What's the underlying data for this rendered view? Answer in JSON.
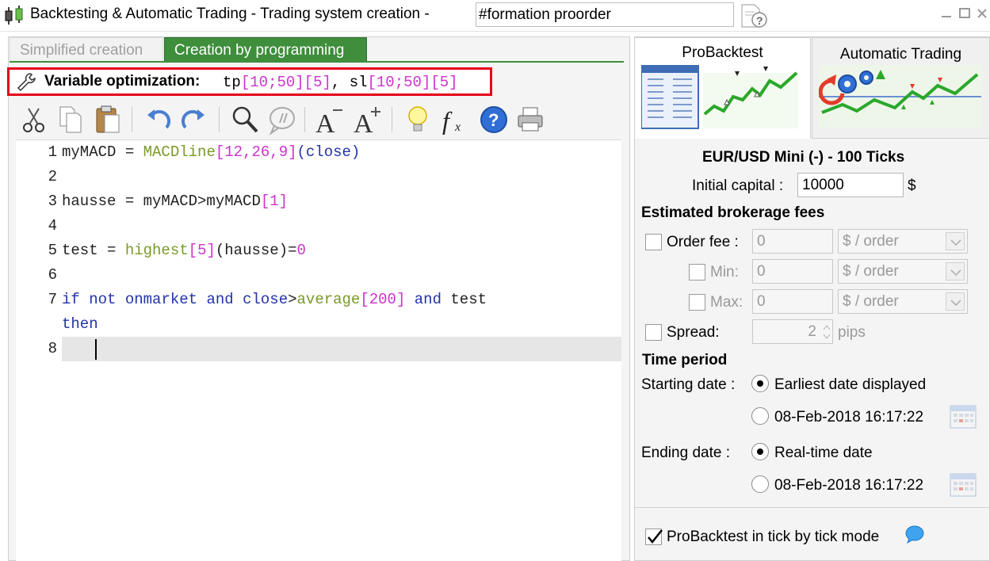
{
  "window": {
    "title": "Backtesting & Automatic Trading - Trading system creation -",
    "system_name": "#formation proorder"
  },
  "tabs": {
    "simplified": "Simplified creation",
    "programming": "Creation by programming"
  },
  "variable_optimization": {
    "label": "Variable optimization:",
    "tp_name": "tp",
    "tp_min": "10",
    "tp_max": "50",
    "tp_step": "5",
    "sl_name": "sl",
    "sl_min": "10",
    "sl_max": "50",
    "sl_step": "5"
  },
  "toolbar": {
    "icons": [
      "cut-icon",
      "copy-icon",
      "paste-icon",
      "undo-icon",
      "redo-icon",
      "search-icon",
      "comment-icon",
      "decrease-font-icon",
      "increase-font-icon",
      "lightbulb-icon",
      "function-icon",
      "help-icon",
      "print-icon"
    ]
  },
  "editor": {
    "line_numbers": [
      "1",
      "2",
      "3",
      "4",
      "5",
      "6",
      "7",
      "8"
    ],
    "l1": {
      "a": "myMACD = ",
      "fn": "MACDline",
      "b": "[",
      "n1": "12",
      "c1": ",",
      "n2": "26",
      "c2": ",",
      "n3": "9",
      "d": "]",
      "e": "(",
      "kw": "close",
      "f": ")"
    },
    "l3": {
      "a": "hausse = myMACD>myMACD",
      "b": "[",
      "n1": "1",
      "c": "]"
    },
    "l5": {
      "a": "test = ",
      "fn": "highest",
      "b": "[",
      "n1": "5",
      "c": "]",
      "d": "(hausse)=",
      "n2": "0"
    },
    "l7": {
      "kw1": "if",
      "kw2": "not",
      "kw3": "onmarket",
      "kw4": "and",
      "kw5": "close",
      "gt": ">",
      "fn": "average",
      "b": "[",
      "n1": "200",
      "c": "]",
      "kw6": "and",
      "e": "test",
      "kw7": "then"
    }
  },
  "right_tabs": {
    "probacktest": "ProBacktest",
    "automatic_trading": "Automatic Trading"
  },
  "instrument": "EUR/USD Mini (-) - 100 Ticks",
  "capital": {
    "label": "Initial capital :",
    "value": "10000",
    "currency": "$"
  },
  "brokerage": {
    "title": "Estimated brokerage fees",
    "order_fee": {
      "label": "Order fee :",
      "value": "0",
      "unit": "$ / order"
    },
    "min": {
      "label": "Min:",
      "value": "0",
      "unit": "$ / order"
    },
    "max": {
      "label": "Max:",
      "value": "0",
      "unit": "$ / order"
    },
    "spread": {
      "label": "Spread:",
      "value": "2",
      "unit": "pips"
    }
  },
  "time_period": {
    "title": "Time period",
    "starting_label": "Starting date :",
    "start_opt1": "Earliest date displayed",
    "start_opt2": "08-Feb-2018 16:17:22",
    "ending_label": "Ending date :",
    "end_opt1": "Real-time date",
    "end_opt2": "08-Feb-2018 16:17:22"
  },
  "tick_mode": {
    "label": "ProBacktest in tick by tick mode",
    "checked": true
  },
  "colors": {
    "accent_green": "#3e8e3c",
    "highlight_red": "#e8001c",
    "keyword_blue": "#2233aa",
    "number_magenta": "#cc33cc",
    "function_green": "#7a9a28"
  }
}
